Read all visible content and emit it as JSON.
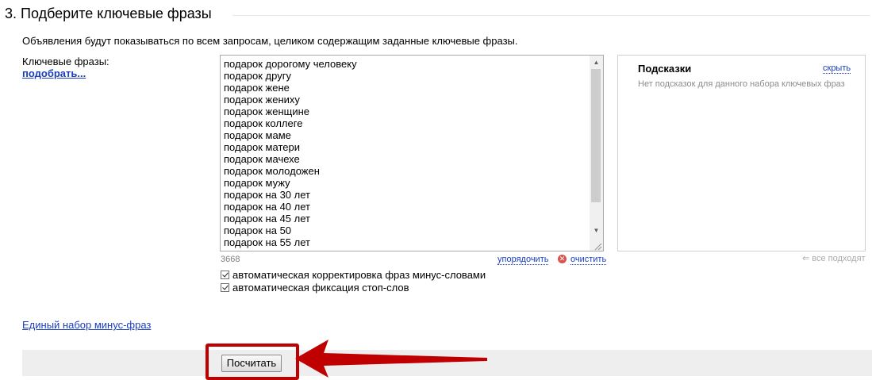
{
  "section": {
    "title": "3. Подберите ключевые фразы",
    "description": "Объявления будут показываться по всем запросам, целиком содержащим заданные ключевые фразы."
  },
  "keywords": {
    "label": "Ключевые фразы:",
    "pick_link": "подобрать...",
    "phrases": [
      "подарок дорогому человеку",
      "подарок другу",
      "подарок жене",
      "подарок жениху",
      "подарок женщине",
      "подарок коллеге",
      "подарок маме",
      "подарок матери",
      "подарок мачехе",
      "подарок молодожен",
      "подарок мужу",
      "подарок на 30 лет",
      "подарок на 40 лет",
      "подарок на 45 лет",
      "подарок на 50",
      "подарок на 55 лет"
    ],
    "count": "3668",
    "sort_link": "упорядочить",
    "clear_link": "очистить"
  },
  "options": {
    "auto_correct_label": "автоматическая корректировка фраз минус-словами",
    "auto_correct_checked": true,
    "auto_stopwords_label": "автоматическая фиксация стоп-слов",
    "auto_stopwords_checked": true
  },
  "hints": {
    "title": "Подсказки",
    "hide_link": "скрыть",
    "empty_text": "Нет подсказок для данного набора ключевых фраз",
    "all_fit": "все подходят"
  },
  "minus_phrases_link": "Единый набор минус-фраз",
  "calculate_button": "Посчитать",
  "colors": {
    "link": "#1a3dc1",
    "highlight": "#c00000",
    "footer_bg": "#eeeeee"
  }
}
